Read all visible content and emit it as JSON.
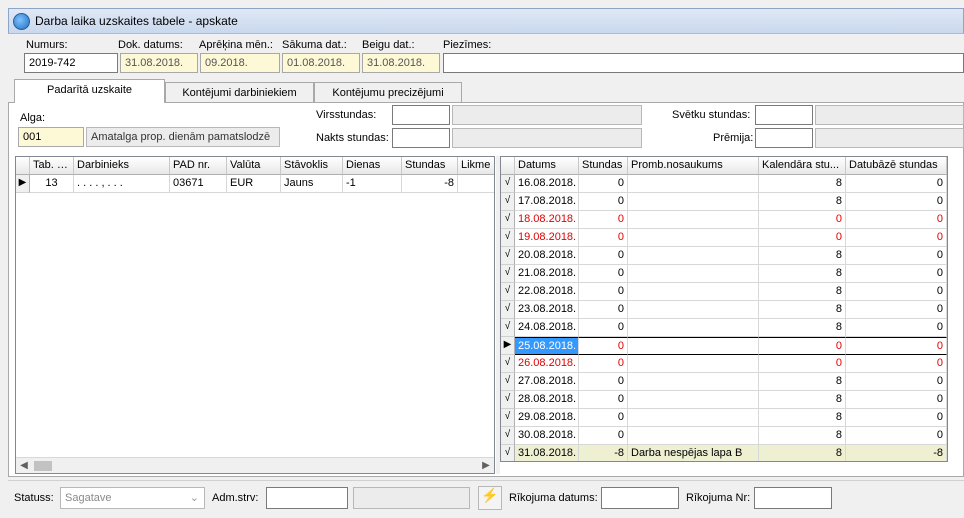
{
  "window": {
    "title": "Darba laika uzskaites tabele - apskate"
  },
  "header": {
    "numurs_label": "Numurs:",
    "numurs_value": "2019-742",
    "dok_datums_label": "Dok. datums:",
    "dok_datums_value": "31.08.2018.",
    "aprekina_men_label": "Aprēķina mēn.:",
    "aprekina_men_value": "09.2018.",
    "sakuma_dat_label": "Sākuma dat.:",
    "sakuma_dat_value": "01.08.2018.",
    "beigu_dat_label": "Beigu dat.:",
    "beigu_dat_value": "31.08.2018.",
    "piezimes_label": "Piezīmes:",
    "piezimes_value": ""
  },
  "tabs": [
    "Padarītā uzskaite",
    "Kontējumi darbiniekiem",
    "Kontējumu precizējumi"
  ],
  "alga": {
    "label": "Alga:",
    "code": "001",
    "description": "Amatalga prop. dienām pamatslodzē"
  },
  "extra": {
    "virsstundas_label": "Virsstundas:",
    "virsstundas_value": "",
    "virsstundas_desc": "",
    "nakts_label": "Nakts stundas:",
    "nakts_value": "",
    "nakts_desc": "",
    "svetku_label": "Svētku stundas:",
    "svetku_value": "",
    "svetku_desc": "",
    "premija_label": "Prēmija:",
    "premija_value": "",
    "premija_desc": ""
  },
  "employees": {
    "columns": [
      "Tab. Nr.",
      "Darbinieks",
      "PAD nr.",
      "Valūta",
      "Stāvoklis",
      "Dienas",
      "Stundas",
      "Likme"
    ],
    "rows": [
      {
        "tab_nr": "13",
        "darbinieks": ". . . . , . . .",
        "pad_nr": "03671",
        "valuta": "EUR",
        "stavoklis": "Jauns",
        "dienas": "-1",
        "stundas": "-8",
        "likme": ""
      }
    ]
  },
  "days": {
    "columns": [
      "Datums",
      "Stundas",
      "Promb.nosaukums",
      "Kalendāra stu...",
      "Datubāzē stundas"
    ],
    "check_glyph": "√",
    "rows": [
      {
        "date": "16.08.2018.",
        "hours": "0",
        "absence": "",
        "cal": "8",
        "db": "0",
        "red": false
      },
      {
        "date": "17.08.2018.",
        "hours": "0",
        "absence": "",
        "cal": "8",
        "db": "0",
        "red": false
      },
      {
        "date": "18.08.2018.",
        "hours": "0",
        "absence": "",
        "cal": "0",
        "db": "0",
        "red": true
      },
      {
        "date": "19.08.2018.",
        "hours": "0",
        "absence": "",
        "cal": "0",
        "db": "0",
        "red": true
      },
      {
        "date": "20.08.2018.",
        "hours": "0",
        "absence": "",
        "cal": "8",
        "db": "0",
        "red": false
      },
      {
        "date": "21.08.2018.",
        "hours": "0",
        "absence": "",
        "cal": "8",
        "db": "0",
        "red": false
      },
      {
        "date": "22.08.2018.",
        "hours": "0",
        "absence": "",
        "cal": "8",
        "db": "0",
        "red": false
      },
      {
        "date": "23.08.2018.",
        "hours": "0",
        "absence": "",
        "cal": "8",
        "db": "0",
        "red": false
      },
      {
        "date": "24.08.2018.",
        "hours": "0",
        "absence": "",
        "cal": "8",
        "db": "0",
        "red": false
      },
      {
        "date": "25.08.2018.",
        "hours": "0",
        "absence": "",
        "cal": "0",
        "db": "0",
        "red": true,
        "selected": true
      },
      {
        "date": "26.08.2018.",
        "hours": "0",
        "absence": "",
        "cal": "0",
        "db": "0",
        "red": true
      },
      {
        "date": "27.08.2018.",
        "hours": "0",
        "absence": "",
        "cal": "8",
        "db": "0",
        "red": false
      },
      {
        "date": "28.08.2018.",
        "hours": "0",
        "absence": "",
        "cal": "8",
        "db": "0",
        "red": false
      },
      {
        "date": "29.08.2018.",
        "hours": "0",
        "absence": "",
        "cal": "8",
        "db": "0",
        "red": false
      },
      {
        "date": "30.08.2018.",
        "hours": "0",
        "absence": "",
        "cal": "8",
        "db": "0",
        "red": false
      },
      {
        "date": "31.08.2018.",
        "hours": "-8",
        "absence": "Darba nespējas lapa  B",
        "cal": "8",
        "db": "-8",
        "red": false,
        "highlight": true
      }
    ]
  },
  "footer": {
    "statuss_label": "Statuss:",
    "statuss_value": "Sagatave",
    "adm_label": "Adm.strv:",
    "adm_value": "",
    "adm_desc": "",
    "rik_datums_label": "Rīkojuma datums:",
    "rik_datums_value": "",
    "rik_nr_label": "Rīkojuma Nr:",
    "rik_nr_value": ""
  },
  "colors": {
    "highlight_row": "#efefd2",
    "selection": "#3399ff",
    "red_text": "#e00000"
  }
}
